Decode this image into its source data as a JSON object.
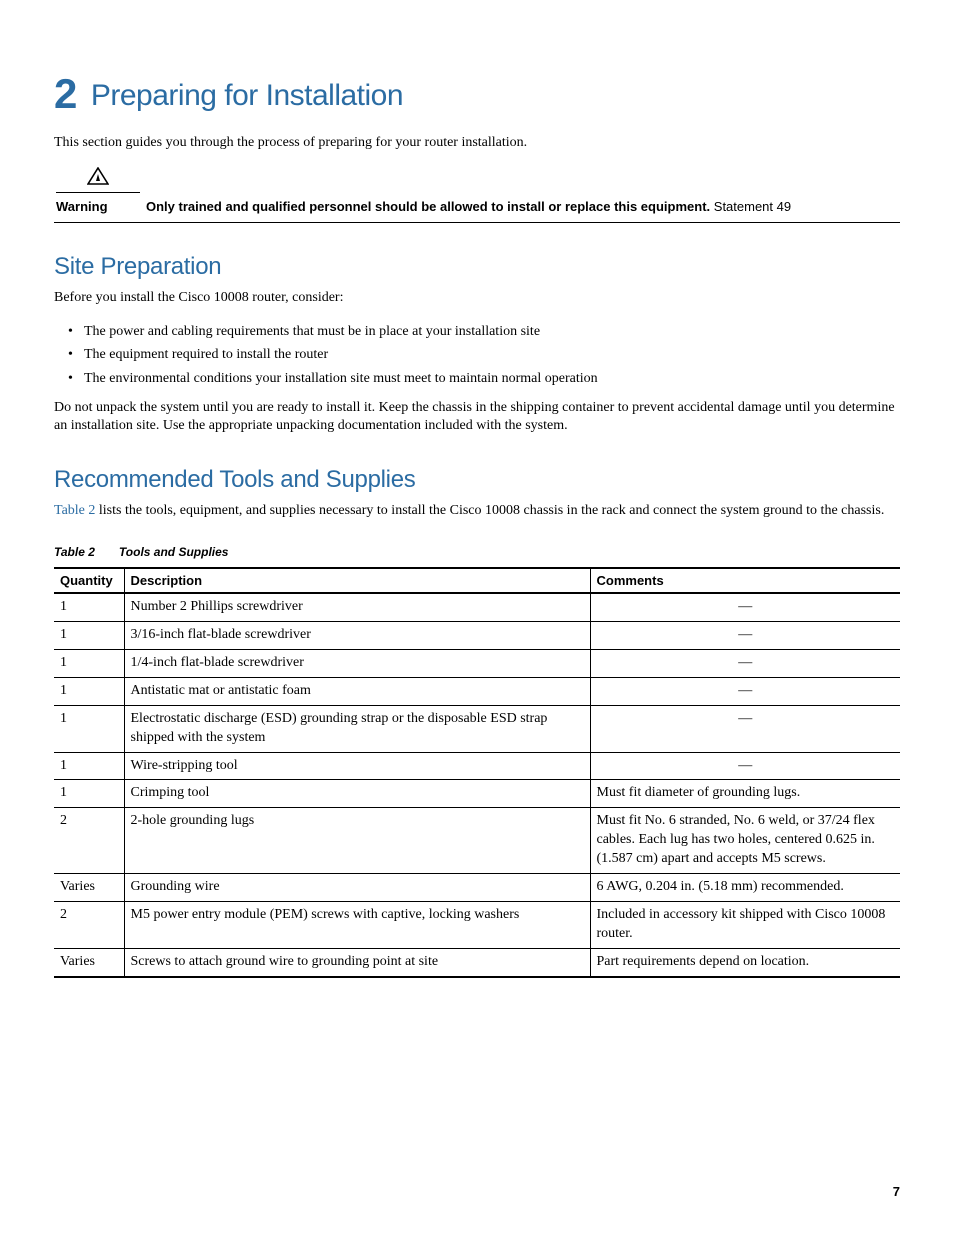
{
  "chapter": {
    "number": "2",
    "title": "Preparing for Installation"
  },
  "intro": "This section guides you through the process of preparing for your router installation.",
  "warning": {
    "label": "Warning",
    "bold": "Only trained and qualified personnel should be allowed to install or replace this equipment.",
    "trail": " Statement 49"
  },
  "sections": {
    "site_prep": {
      "title": "Site Preparation",
      "lead": "Before you install the Cisco 10008 router, consider:",
      "bullets": [
        "The power and cabling requirements that must be in place at your installation site",
        "The equipment required to install the router",
        "The environmental conditions your installation site must meet to maintain normal operation"
      ],
      "tail": "Do not unpack the system until you are ready to install it. Keep the chassis in the shipping container to prevent accidental damage until you determine an installation site. Use the appropriate unpacking documentation included with the system."
    },
    "recommended": {
      "title": "Recommended Tools and Supplies",
      "xref": "Table 2",
      "lead_rest": " lists the tools, equipment, and supplies necessary to install the Cisco 10008 chassis in the rack and connect the system ground to the chassis."
    }
  },
  "table": {
    "caption_num": "Table 2",
    "caption_title": "Tools and Supplies",
    "headers": {
      "qty": "Quantity",
      "desc": "Description",
      "comm": "Comments"
    },
    "em": "—",
    "rows": [
      {
        "qty": "1",
        "desc": "Number 2 Phillips screwdriver",
        "comm": "—",
        "center": true
      },
      {
        "qty": "1",
        "desc": "3/16-inch flat-blade screwdriver",
        "comm": "—",
        "center": true
      },
      {
        "qty": "1",
        "desc": "1/4-inch flat-blade screwdriver",
        "comm": "—",
        "center": true
      },
      {
        "qty": "1",
        "desc": "Antistatic mat or antistatic foam",
        "comm": "—",
        "center": true
      },
      {
        "qty": "1",
        "desc": "Electrostatic discharge (ESD) grounding strap or the disposable ESD strap shipped with the system",
        "comm": "—",
        "center": true
      },
      {
        "qty": "1",
        "desc": "Wire-stripping tool",
        "comm": "—",
        "center": true
      },
      {
        "qty": "1",
        "desc": "Crimping tool",
        "comm": "Must fit diameter of grounding lugs.",
        "center": false
      },
      {
        "qty": "2",
        "desc": "2-hole grounding lugs",
        "comm": "Must fit No. 6 stranded, No. 6 weld, or 37/24 flex cables. Each lug has two holes, centered 0.625 in. (1.587 cm) apart and accepts M5 screws.",
        "center": false
      },
      {
        "qty": "Varies",
        "desc": "Grounding wire",
        "comm": "6 AWG, 0.204 in. (5.18 mm) recommended.",
        "center": false
      },
      {
        "qty": "2",
        "desc": "M5 power entry module (PEM) screws with captive, locking washers",
        "comm": "Included in accessory kit shipped with Cisco 10008 router.",
        "center": false
      },
      {
        "qty": "Varies",
        "desc": "Screws to attach ground wire to grounding point at site",
        "comm": "Part requirements depend on location.",
        "center": false
      }
    ]
  },
  "page_number": "7"
}
